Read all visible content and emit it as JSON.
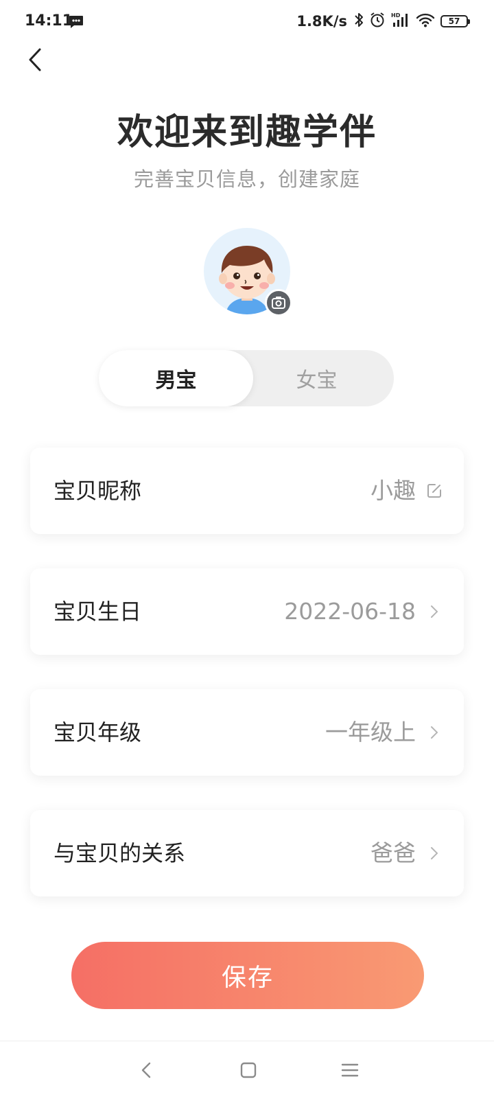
{
  "status_bar": {
    "time": "14:11",
    "network_speed": "1.8K/s",
    "battery": "57",
    "icons": [
      "message-icon",
      "bluetooth-icon",
      "alarm-icon",
      "signal-hd-icon",
      "wifi-icon",
      "battery-icon"
    ]
  },
  "header": {
    "title": "欢迎来到趣学伴",
    "subtitle": "完善宝贝信息，创建家庭"
  },
  "gender_toggle": {
    "male_label": "男宝",
    "female_label": "女宝",
    "selected": "male"
  },
  "fields": [
    {
      "label": "宝贝昵称",
      "value": "小趣",
      "icon": "edit-icon"
    },
    {
      "label": "宝贝生日",
      "value": "2022-06-18",
      "icon": "chevron-right-icon"
    },
    {
      "label": "宝贝年级",
      "value": "一年级上",
      "icon": "chevron-right-icon"
    },
    {
      "label": "与宝贝的关系",
      "value": "爸爸",
      "icon": "chevron-right-icon"
    }
  ],
  "save_label": "保存",
  "colors": {
    "save_gradient_start": "#f56f65",
    "save_gradient_end": "#f99a73",
    "avatar_bg": "#e6f2fc"
  }
}
